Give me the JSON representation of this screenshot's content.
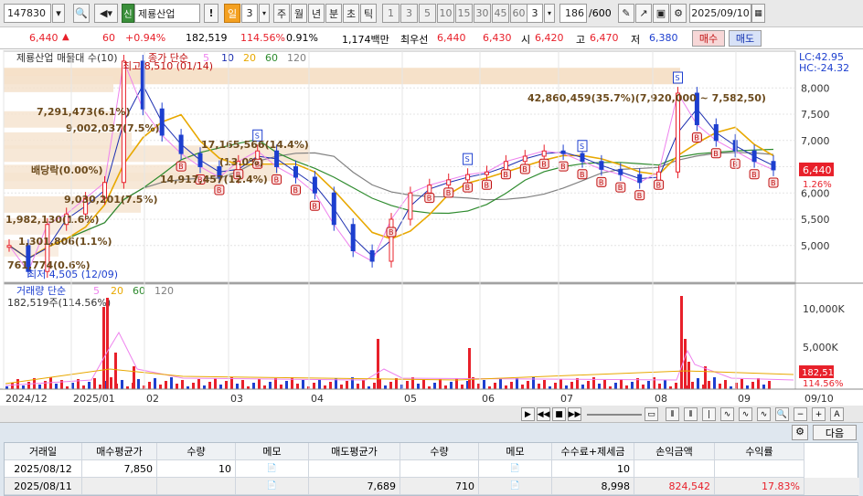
{
  "toolbar": {
    "code": "147830",
    "stock_badge": "신",
    "stock_name": "제룡산업",
    "info_btn": "!",
    "period_sel": "일",
    "period_num": "3",
    "periods": [
      "주",
      "월",
      "년",
      "분",
      "초",
      "틱"
    ],
    "intervals": [
      "1",
      "3",
      "5",
      "10",
      "15",
      "30",
      "45",
      "60"
    ],
    "interval_cur": "3",
    "count": "186",
    "count_total": "/600",
    "date": "2025/09/10"
  },
  "quote": {
    "price": "6,440",
    "change": "60",
    "pct": "+0.94%",
    "volume": "182,519",
    "vol_ratio": "114.56%",
    "turnover": "0.91%",
    "amount": "1,174백만",
    "best_ask_label": "최우선",
    "best_ask": "6,440",
    "best_bid": "6,430",
    "open_label": "시",
    "open": "6,420",
    "high_label": "고",
    "high": "6,470",
    "low_label": "저",
    "low": "6,380",
    "buy_btn": "매수",
    "sell_btn": "매도"
  },
  "chart": {
    "legend_name": "제룡산업 매물대 수(10)",
    "legend_ma_prefix": "종가 단순",
    "ma_periods": [
      "5",
      "10",
      "20",
      "60",
      "120"
    ],
    "lc_label": "LC:42.95",
    "hc_label": "HC:-24.32",
    "price_axis": [
      "8,000",
      "7,500",
      "7,000",
      "6,500",
      "6,000",
      "5,500",
      "5,000"
    ],
    "cur_price_tag": "6,440",
    "cur_pct_tag": "1.26%",
    "high_label": "최고 8,510 (01/14)",
    "low_label": "최저 4,505 (12/09)",
    "profile_labels": [
      "7,291,473(6.1%)",
      "9,002,037(7.5%)",
      "17,165,566(14.4%)",
      "(13.0%)",
      "14,917,457(12.4%)",
      "배당락(0.00%)",
      "9,030,201(7.5%)",
      "1,982,130(1.6%)",
      "1,301,806(1.1%)",
      "761,774(0.6%)",
      "42,860,459(35.7%)(7,920,000 ~ 7,582,50)"
    ],
    "vol_legend_name": "거래량 단순",
    "vol_periods": [
      "5",
      "20",
      "60",
      "120"
    ],
    "vol_value": "182,519주(114.56%)",
    "vol_axis": [
      "10,000K",
      "5,000K"
    ],
    "vol_tag": "182,519",
    "vol_pct_tag": "114.56%",
    "date_axis": [
      "2024/12",
      "2025/01",
      "02",
      "03",
      "04",
      "05",
      "06",
      "07",
      "08",
      "09",
      "09/10"
    ],
    "colors": {
      "up": "#e8202a",
      "down": "#1d3fcf",
      "ma5": "#ee82ee",
      "ma10": "#1c2fb0",
      "ma20": "#e8a800",
      "ma60": "#2e8b2e",
      "ma120": "#808080"
    }
  },
  "chart_data": {
    "type": "line",
    "title": "제룡산업",
    "x_range": [
      "2024/12",
      "2025/09/10"
    ],
    "ylim": [
      4300,
      8700
    ],
    "series": [
      {
        "name": "종가",
        "values": [
          5000,
          4505,
          5400,
          5600,
          5900,
          6200,
          8510,
          7600,
          7100,
          6750,
          6500,
          6300,
          6600,
          6800,
          6500,
          6300,
          6000,
          5400,
          4900,
          4700,
          5500,
          6000,
          6150,
          6250,
          6350,
          6400,
          6600,
          6700,
          6800,
          6750,
          6600,
          6450,
          6350,
          6200,
          6400,
          7900,
          7300,
          7000,
          6800,
          6600,
          6440
        ]
      }
    ]
  },
  "controls": {
    "right_btn": "다음"
  },
  "table": {
    "headers": [
      "거래일",
      "매수평균가",
      "수량",
      "메모",
      "매도평균가",
      "수량",
      "메모",
      "수수료+제세금",
      "손익금액",
      "수익률"
    ],
    "rows": [
      [
        "2025/08/12",
        "7,850",
        "10",
        "",
        "",
        "",
        "",
        "10",
        "",
        ""
      ],
      [
        "2025/08/11",
        "",
        "",
        "",
        "7,689",
        "710",
        "",
        "8,998",
        "824,542",
        "17.83%"
      ]
    ]
  }
}
